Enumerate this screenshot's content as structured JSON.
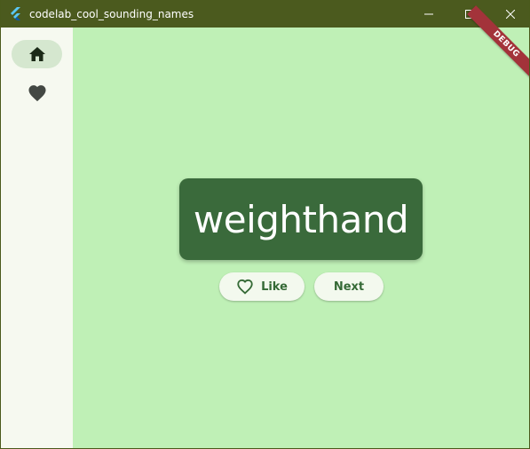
{
  "window": {
    "title": "codelab_cool_sounding_names",
    "icons": {
      "app": "flutter-logo-icon",
      "minimize": "minimize-icon",
      "maximize": "maximize-icon",
      "close": "close-icon"
    }
  },
  "sidebar": {
    "items": [
      {
        "icon": "home-icon",
        "selected": true
      },
      {
        "icon": "heart-icon",
        "selected": false
      }
    ]
  },
  "main": {
    "current_word": "weighthand",
    "like_button": {
      "label": "Like",
      "icon": "heart-outline-icon"
    },
    "next_button": {
      "label": "Next"
    }
  },
  "debug_banner": "DEBUG",
  "colors": {
    "titlebar": "#4b5a1e",
    "sidebar_bg": "#f6f9f0",
    "main_bg": "#bff0b6",
    "card_bg": "#3a6a3b",
    "accent": "#356a36",
    "selected_indicator": "#d5e7cf",
    "debug_banner": "#a3333a"
  }
}
